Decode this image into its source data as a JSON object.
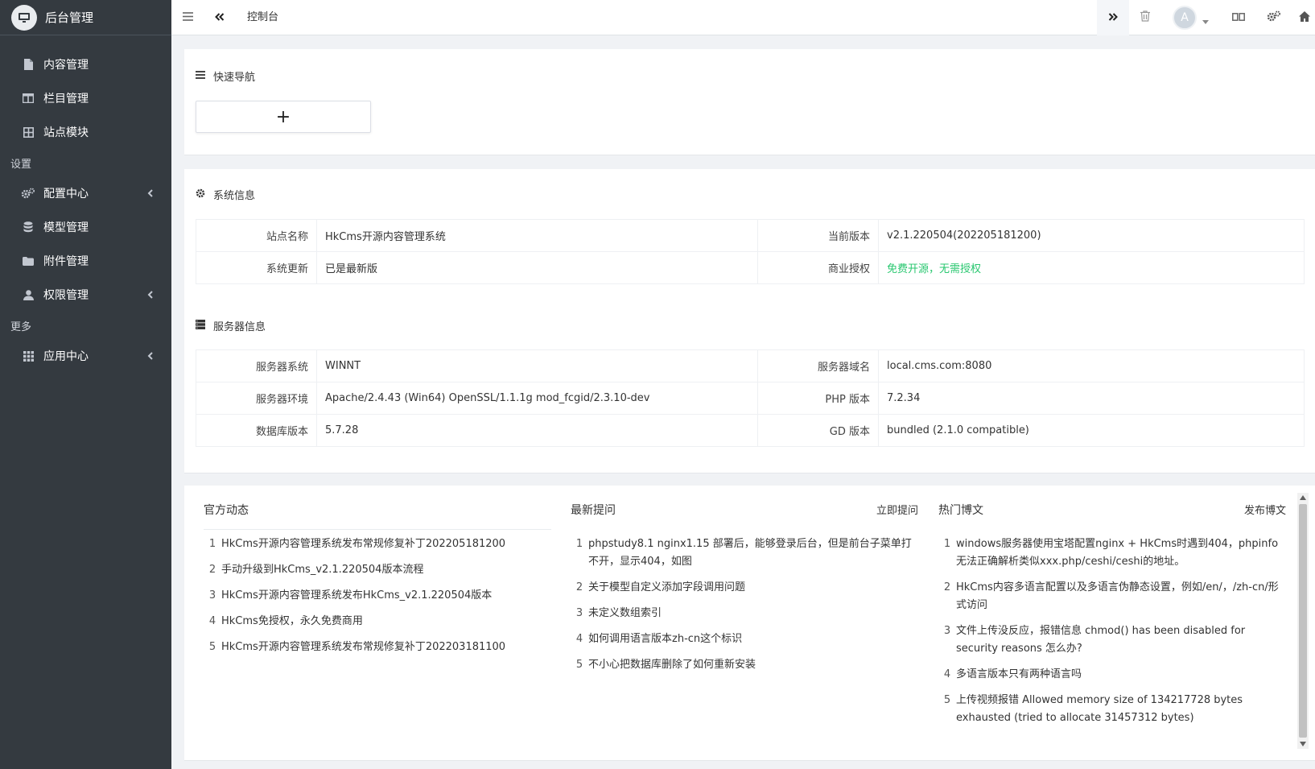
{
  "brand": {
    "title": "后台管理"
  },
  "sidebar": {
    "items": [
      {
        "label": "内容管理",
        "icon": "file-icon"
      },
      {
        "label": "栏目管理",
        "icon": "columns-icon"
      },
      {
        "label": "站点模块",
        "icon": "grid-icon"
      }
    ],
    "header_settings": "设置",
    "settings_items": [
      {
        "label": "配置中心",
        "icon": "cogs-icon"
      },
      {
        "label": "模型管理",
        "icon": "database-icon"
      },
      {
        "label": "附件管理",
        "icon": "folder-icon"
      },
      {
        "label": "权限管理",
        "icon": "user-icon"
      }
    ],
    "header_more": "更多",
    "more_items": [
      {
        "label": "应用中心",
        "icon": "apps-icon"
      }
    ]
  },
  "topbar": {
    "tab_title": "控制台",
    "avatar_letter": "A"
  },
  "quick_nav": {
    "title": "快速导航",
    "add_label": "+"
  },
  "system_info": {
    "title": "系统信息",
    "rows": [
      {
        "l1": "站点名称",
        "v1": "HkCms开源内容管理系统",
        "l2": "当前版本",
        "v2": "v2.1.220504(202205181200)"
      },
      {
        "l1": "系统更新",
        "v1": "已是最新版",
        "l2": "商业授权",
        "v2": "免费开源，无需授权"
      }
    ]
  },
  "server_info": {
    "title": "服务器信息",
    "rows": [
      {
        "l1": "服务器系统",
        "v1": "WINNT",
        "l2": "服务器域名",
        "v2": "local.cms.com:8080"
      },
      {
        "l1": "服务器环境",
        "v1": "Apache/2.4.43 (Win64) OpenSSL/1.1.1g mod_fcgid/2.3.10-dev",
        "l2": "PHP 版本",
        "v2": "7.2.34"
      },
      {
        "l1": "数据库版本",
        "v1": "5.7.28",
        "l2": "GD 版本",
        "v2": "bundled (2.1.0 compatible)"
      }
    ]
  },
  "colors": {
    "sidebar_bg": "#343a40",
    "accent_green": "#28c76f",
    "page_bg": "#f0f2f5"
  },
  "news": {
    "title": "官方动态",
    "items": [
      "HkCms开源内容管理系统发布常规修复补丁202205181200",
      "手动升级到HkCms_v2.1.220504版本流程",
      "HkCms开源内容管理系统发布HkCms_v2.1.220504版本",
      "HkCms免授权，永久免费商用",
      "HkCms开源内容管理系统发布常规修复补丁202203181100"
    ]
  },
  "questions": {
    "title": "最新提问",
    "link": "立即提问",
    "items": [
      "phpstudy8.1 nginx1.15 部署后，能够登录后台，但是前台子菜单打不开，显示404，如图",
      "关于模型自定义添加字段调用问题",
      "未定义数组索引",
      "如何调用语言版本zh-cn这个标识",
      "不小心把数据库删除了如何重新安装"
    ]
  },
  "blogs": {
    "title": "热门博文",
    "link": "发布博文",
    "items": [
      "windows服务器使用宝塔配置nginx + HkCms时遇到404，phpinfo无法正确解析类似xxx.php/ceshi/ceshi的地址。",
      "HkCms内容多语言配置以及多语言伪静态设置，例如/en/，/zh-cn/形式访问",
      "文件上传没反应，报错信息 chmod() has been disabled for security reasons 怎么办?",
      "多语言版本只有两种语言吗",
      "上传视频报错 Allowed memory size of 134217728 bytes exhausted (tried to allocate 31457312 bytes)"
    ]
  }
}
